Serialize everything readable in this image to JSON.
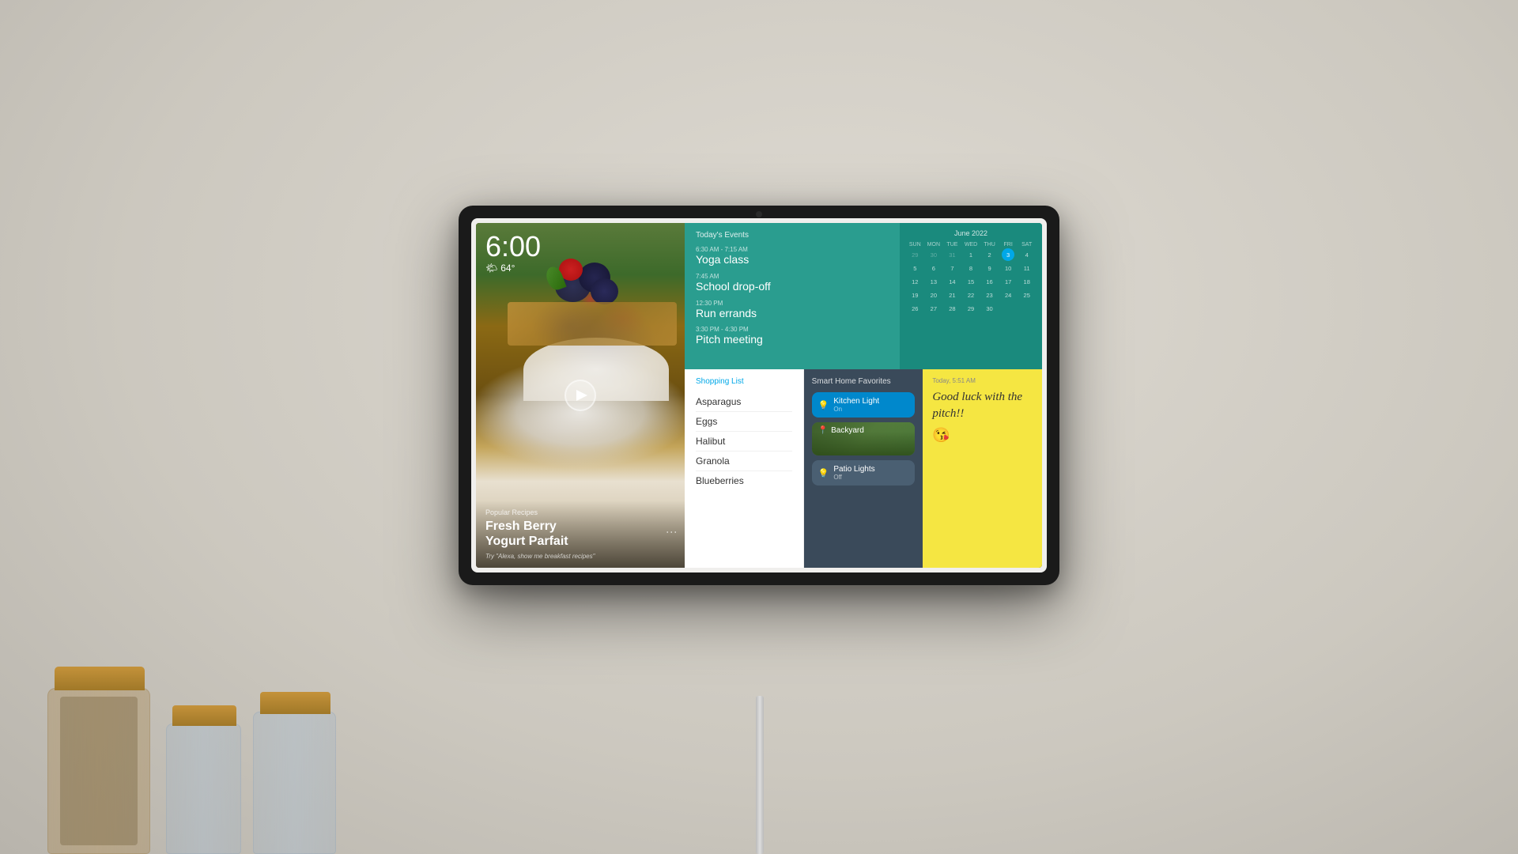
{
  "device": {
    "frame_color": "#1a1a1a"
  },
  "time_weather": {
    "time": "6:00",
    "temperature": "64°",
    "weather_icon": "🌤"
  },
  "recipe": {
    "tag": "Popular Recipes",
    "title": "Fresh Berry\nYogurt Parfait",
    "hint": "Try \"Alexa, show me breakfast recipes\""
  },
  "events": {
    "section_title": "Today's Events",
    "items": [
      {
        "time": "6:30 AM - 7:15 AM",
        "name": "Yoga class"
      },
      {
        "time": "7:45 AM",
        "name": "School drop-off"
      },
      {
        "time": "12:30 PM",
        "name": "Run errands"
      },
      {
        "time": "3:30 PM - 4:30 PM",
        "name": "Pitch meeting"
      }
    ]
  },
  "calendar": {
    "month_year": "June 2022",
    "headers": [
      "SUN",
      "MON",
      "TUE",
      "WED",
      "THU",
      "FRI",
      "SAT"
    ],
    "weeks": [
      [
        "29",
        "30",
        "31",
        "1",
        "2",
        "3",
        "4"
      ],
      [
        "5",
        "6",
        "7",
        "8",
        "9",
        "10",
        "11"
      ],
      [
        "12",
        "13",
        "14",
        "15",
        "16",
        "17",
        "18"
      ],
      [
        "19",
        "20",
        "21",
        "22",
        "23",
        "24",
        "25"
      ],
      [
        "26",
        "27",
        "28",
        "29",
        "30",
        "",
        ""
      ]
    ],
    "today": "3"
  },
  "shopping_list": {
    "title": "Shopping List",
    "items": [
      "Asparagus",
      "Eggs",
      "Halibut",
      "Granola",
      "Blueberries"
    ]
  },
  "smart_home": {
    "title": "Smart Home Favorites",
    "devices": [
      {
        "name": "Kitchen Light",
        "status": "On",
        "active": true,
        "icon": "💡"
      },
      {
        "name": "Backyard",
        "status": "",
        "active": false,
        "icon": "📍",
        "is_image": true
      },
      {
        "name": "Patio Lights",
        "status": "Off",
        "active": false,
        "icon": "💡"
      }
    ]
  },
  "note": {
    "time": "Today, 5:51 AM",
    "text": "Good luck with the pitch!!",
    "emoji": "😘"
  }
}
